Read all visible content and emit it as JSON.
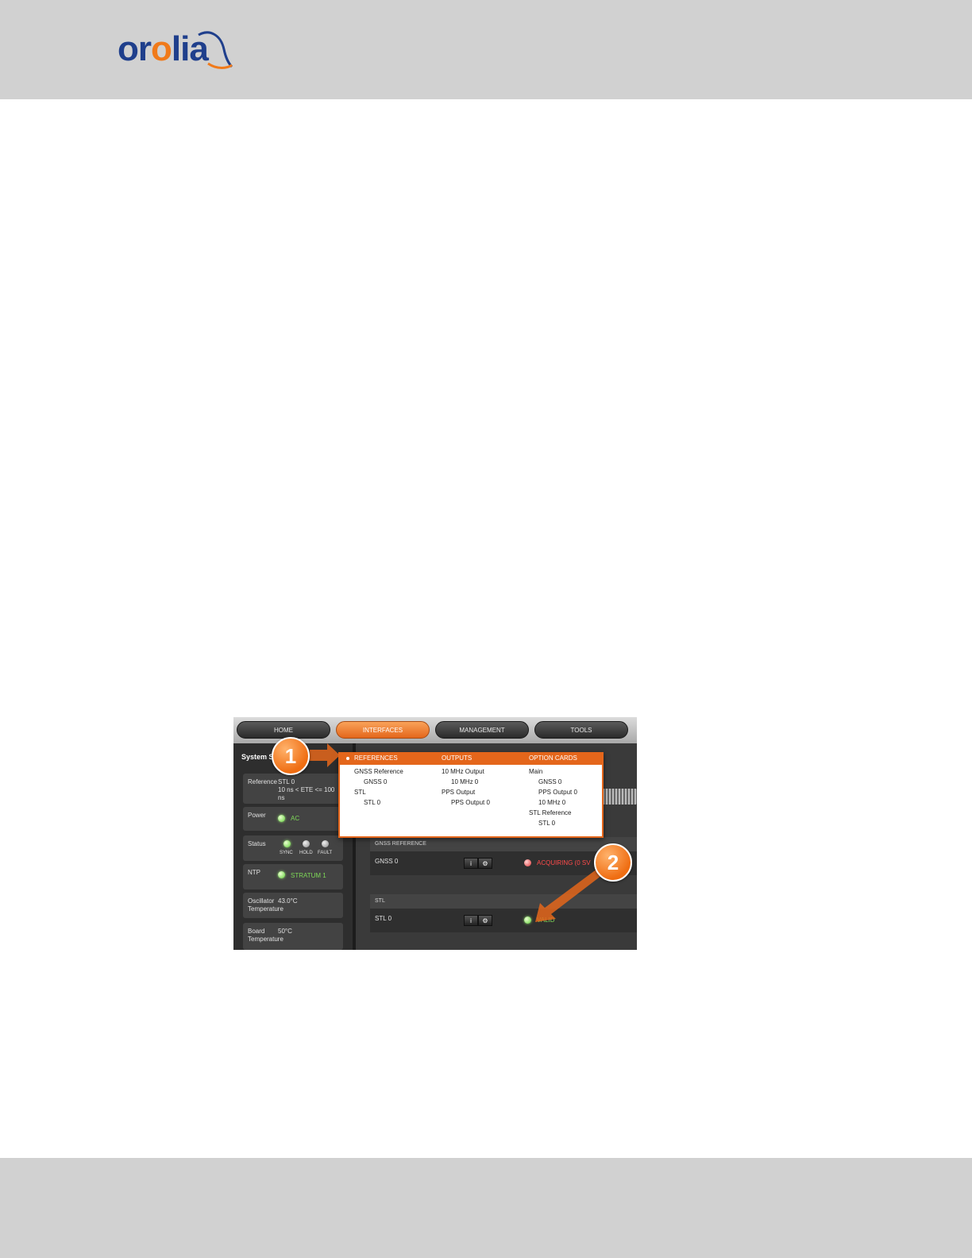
{
  "header": {
    "logo": {
      "text_1": "or",
      "text_2": "o",
      "text_3": "lia",
      "accent": "#f07a1a",
      "brand": "#1f3f8c"
    }
  },
  "ui": {
    "tabs": [
      {
        "label": "HOME"
      },
      {
        "label": "INTERFACES"
      },
      {
        "label": "MANAGEMENT"
      },
      {
        "label": "TOOLS"
      }
    ],
    "left_panel": {
      "title": "System St",
      "reference": {
        "label": "Reference",
        "value_1": "STL 0",
        "value_2": "10 ns < ETE <= 100",
        "value_3": "ns"
      },
      "power": {
        "label": "Power",
        "value": "AC"
      },
      "status": {
        "label": "Status",
        "leds": [
          "SYNC",
          "HOLD",
          "FAULT"
        ]
      },
      "ntp": {
        "label": "NTP",
        "value": "STRATUM 1"
      },
      "oscillator": {
        "label_1": "Oscillator",
        "label_2": "Temperature",
        "value": "43.0°C"
      },
      "board": {
        "label_1": "Board",
        "label_2": "Temperature",
        "value": "50°C"
      }
    },
    "dropdown": {
      "columns": [
        {
          "heading": "REFERENCES",
          "items": [
            "GNSS Reference",
            "GNSS 0",
            "STL",
            "STL 0"
          ]
        },
        {
          "heading": "OUTPUTS",
          "items": [
            "10 MHz Output",
            "10 MHz 0",
            "PPS Output",
            "PPS Output 0"
          ]
        },
        {
          "heading": "OPTION CARDS",
          "items": [
            "Main",
            "GNSS 0",
            "PPS Output 0",
            "10 MHz 0",
            "STL Reference",
            "STL 0"
          ]
        }
      ]
    },
    "main_panel": {
      "gnss_section": "GNSS REFERENCE",
      "gnss_row": {
        "name": "GNSS 0",
        "status": "ACQUIRING (0 SV"
      },
      "stl_section": "STL",
      "stl_row": {
        "name": "STL 0",
        "status": "VALID"
      },
      "info_glyph": "i",
      "gear_glyph": "⚙"
    },
    "callouts": [
      "1",
      "2"
    ]
  }
}
